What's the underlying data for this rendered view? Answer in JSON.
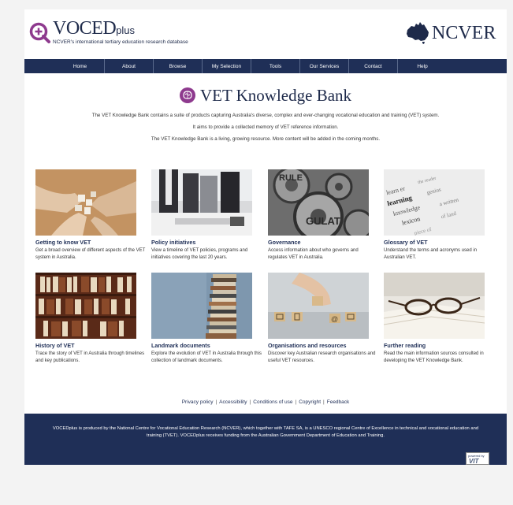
{
  "header": {
    "logo_main": "VOCED",
    "logo_suffix": "plus",
    "tagline": "NCVER's international tertiary education research database",
    "ncver": "NCVER"
  },
  "nav": {
    "items": [
      {
        "label": "Home"
      },
      {
        "label": "About"
      },
      {
        "label": "Browse"
      },
      {
        "label": "My Selection"
      },
      {
        "label": "Tools"
      },
      {
        "label": "Our Services"
      },
      {
        "label": "Contact"
      },
      {
        "label": "Help"
      }
    ]
  },
  "hero": {
    "title": "VET Knowledge Bank",
    "line1": "The VET Knowledge Bank contains a suite of products capturing Australia's diverse, complex and ever-changing vocational education and training (VET) system.",
    "line2": "It aims to provide a collected memory of VET reference information.",
    "line3": "The VET Knowledge Bank is a living, growing resource. More content will be added in the coming months."
  },
  "cards": [
    {
      "title": "Getting to know VET",
      "desc": "Get a broad overview of different aspects of the VET system in Australia."
    },
    {
      "title": "Policy initiatives",
      "desc": "View a timeline of VET policies, programs and initiatives covering the last 20 years."
    },
    {
      "title": "Governance",
      "desc": "Access information about who governs and regulates VET in Australia."
    },
    {
      "title": "Glossary of VET",
      "desc": "Understand the terms and acronyms used in Australian VET."
    },
    {
      "title": "History of VET",
      "desc": "Trace the story of VET in Australia through timelines and key publications."
    },
    {
      "title": "Landmark documents",
      "desc": "Explore the evolution of VET in Australia through this collection of landmark documents."
    },
    {
      "title": "Organisations and resources",
      "desc": "Discover key Australian research organisations and useful VET resources."
    },
    {
      "title": "Further reading",
      "desc": "Read the main information sources consulted in developing the VET Knowledge Bank."
    }
  ],
  "footer_links": {
    "privacy": "Privacy policy",
    "accessibility": "Accessibility",
    "conditions": "Conditions of use",
    "copyright": "Copyright",
    "feedback": "Feedback"
  },
  "footer": {
    "line1": "VOCEDplus is produced by the National Centre for Vocational Education Research (NCVER), which together with TAFE SA, is a UNESCO regional Centre of Excellence in technical and vocational education and",
    "line2": "training (TVET). VOCEDplus receives funding from the Australian Government Department of Education and Training.",
    "powered_by": "powered by",
    "powered_brand": "VIT"
  },
  "colors": {
    "navy": "#1f2f57",
    "accent_purple": "#8e3a8e"
  }
}
